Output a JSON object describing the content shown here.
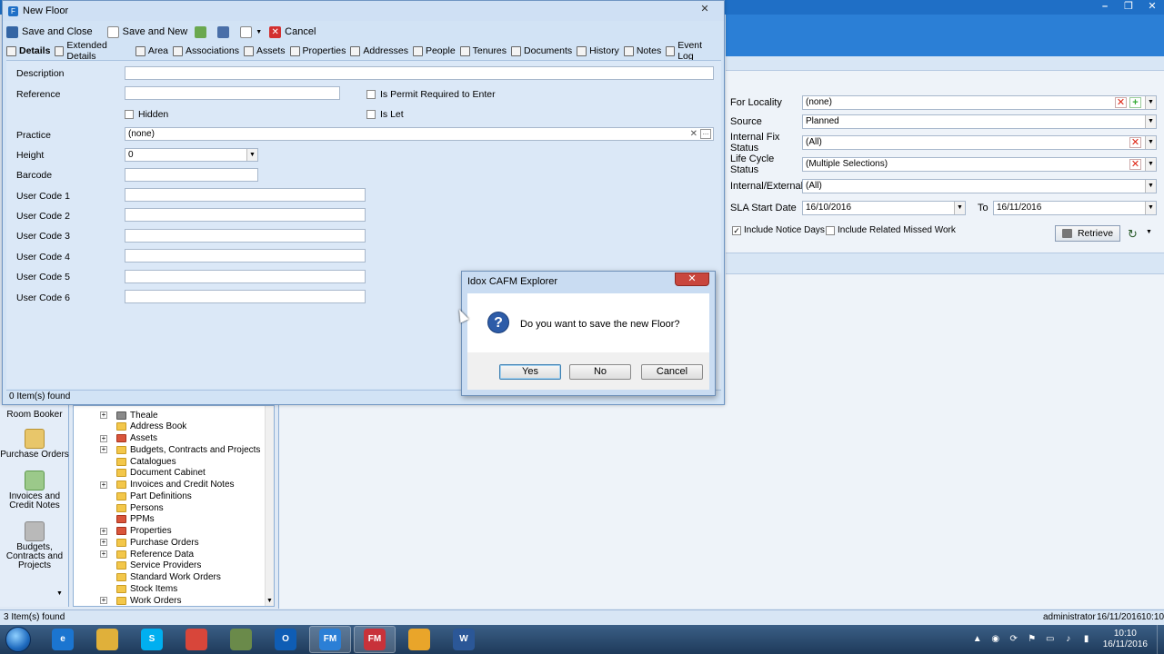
{
  "background": {
    "filters": {
      "for_locality_label": "For Locality",
      "for_locality_value": "(none)",
      "source_label": "Source",
      "source_value": "Planned",
      "internal_fix_status_label": "Internal Fix Status",
      "internal_fix_status_value": "(All)",
      "life_cycle_status_label": "Life Cycle Status",
      "life_cycle_status_value": "(Multiple Selections)",
      "internal_external_label": "Internal/External",
      "internal_external_value": "(All)",
      "sla_start_date_label": "SLA Start Date",
      "sla_start_date_value": "16/10/2016",
      "to_label": "To",
      "to_value": "16/11/2016",
      "include_notice_days_label": "Include Notice Days",
      "include_notice_days_checked": true,
      "include_related_missed_work_label": "Include Related Missed Work",
      "include_related_missed_work_checked": false,
      "retrieve_label": "Retrieve"
    },
    "leftnav": [
      {
        "label": "Room Booker"
      },
      {
        "label": "Purchase Orders"
      },
      {
        "label": "Invoices and Credit Notes"
      },
      {
        "label": "Budgets, Contracts and Projects"
      }
    ],
    "tree": [
      {
        "label": "Theale",
        "expandable": true,
        "icon": "building-icon"
      },
      {
        "label": "Address Book",
        "expandable": false,
        "icon": "folder-icon"
      },
      {
        "label": "Assets",
        "expandable": true,
        "icon": "folder-red-icon"
      },
      {
        "label": "Budgets, Contracts and Projects",
        "expandable": true,
        "icon": "folder-icon"
      },
      {
        "label": "Catalogues",
        "expandable": false,
        "icon": "folder-icon"
      },
      {
        "label": "Document Cabinet",
        "expandable": false,
        "icon": "folder-icon"
      },
      {
        "label": "Invoices and Credit Notes",
        "expandable": true,
        "icon": "folder-icon"
      },
      {
        "label": "Part Definitions",
        "expandable": false,
        "icon": "folder-icon"
      },
      {
        "label": "Persons",
        "expandable": false,
        "icon": "folder-icon"
      },
      {
        "label": "PPMs",
        "expandable": false,
        "icon": "folder-red-icon"
      },
      {
        "label": "Properties",
        "expandable": true,
        "icon": "folder-red-icon"
      },
      {
        "label": "Purchase Orders",
        "expandable": true,
        "icon": "folder-icon"
      },
      {
        "label": "Reference Data",
        "expandable": true,
        "icon": "folder-icon"
      },
      {
        "label": "Service Providers",
        "expandable": false,
        "icon": "folder-icon"
      },
      {
        "label": "Standard Work Orders",
        "expandable": false,
        "icon": "folder-icon"
      },
      {
        "label": "Stock Items",
        "expandable": false,
        "icon": "folder-icon"
      },
      {
        "label": "Work Orders",
        "expandable": true,
        "icon": "folder-icon"
      }
    ],
    "status_left": "3 Item(s) found",
    "status_user": "administrator",
    "status_date": "16/11/2016",
    "status_time": "10:10"
  },
  "new_floor": {
    "title": "New Floor",
    "toolbar": {
      "save_close": "Save and Close",
      "save_new": "Save and New",
      "cancel": "Cancel"
    },
    "tabs": [
      "Details",
      "Extended Details",
      "Area",
      "Associations",
      "Assets",
      "Properties",
      "Addresses",
      "People",
      "Tenures",
      "Documents",
      "History",
      "Notes",
      "Event Log"
    ],
    "form": {
      "description_label": "Description",
      "description_value": "",
      "reference_label": "Reference",
      "reference_value": "",
      "permit_label": "Is Permit Required to Enter",
      "hidden_label": "Hidden",
      "is_let_label": "Is Let",
      "practice_label": "Practice",
      "practice_value": "(none)",
      "height_label": "Height",
      "height_value": "0",
      "barcode_label": "Barcode",
      "barcode_value": "",
      "user_code_1_label": "User Code 1",
      "user_code_2_label": "User Code 2",
      "user_code_3_label": "User Code 3",
      "user_code_4_label": "User Code 4",
      "user_code_5_label": "User Code 5",
      "user_code_6_label": "User Code 6"
    },
    "status": "0 Item(s) found"
  },
  "dialog": {
    "title": "Idox CAFM Explorer",
    "message": "Do you want to save the new Floor?",
    "yes": "Yes",
    "no": "No",
    "cancel": "Cancel"
  },
  "taskbar": {
    "apps": [
      {
        "name": "internet-explorer-icon",
        "color": "#1b75d0",
        "label": "e"
      },
      {
        "name": "file-explorer-icon",
        "color": "#e0b03a",
        "label": ""
      },
      {
        "name": "skype-icon",
        "color": "#00aff0",
        "label": "S"
      },
      {
        "name": "chrome-icon",
        "color": "#d8463a",
        "label": ""
      },
      {
        "name": "tools-icon",
        "color": "#6a8a4a",
        "label": ""
      },
      {
        "name": "outlook-icon",
        "color": "#0f5db5",
        "label": "O"
      },
      {
        "name": "fm-app-icon",
        "color": "#2b7fd6",
        "label": "FM"
      },
      {
        "name": "fm-app-red-icon",
        "color": "#c8323a",
        "label": "FM"
      },
      {
        "name": "pinwheel-app-icon",
        "color": "#e9a52a",
        "label": ""
      },
      {
        "name": "word-icon",
        "color": "#2b5797",
        "label": "W"
      }
    ],
    "clock_time": "10:10",
    "clock_date": "16/11/2016"
  }
}
